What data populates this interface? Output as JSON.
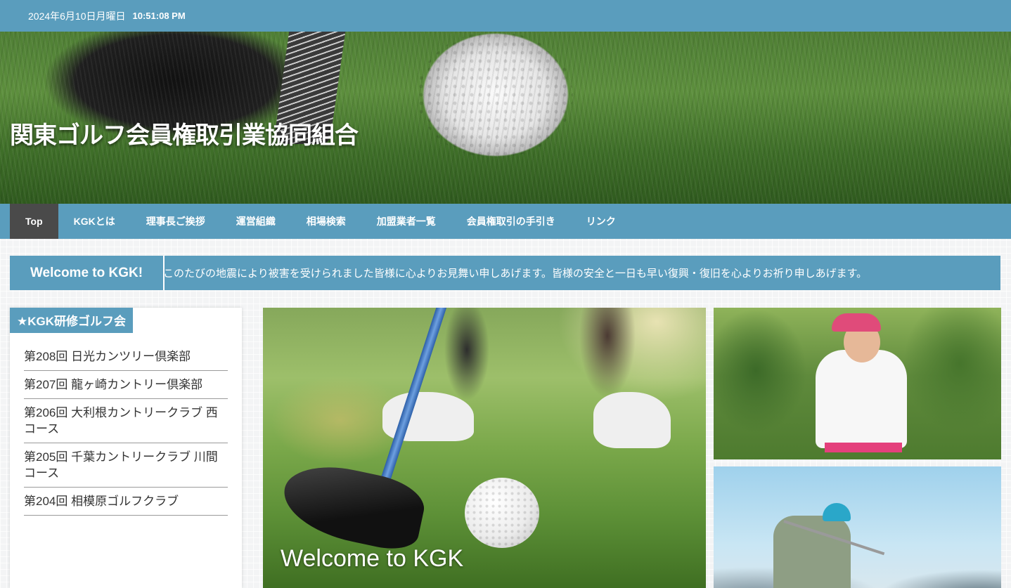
{
  "topbar": {
    "date": "2024年6月10日月曜日",
    "time": "10:51:08 PM"
  },
  "header": {
    "site_title": "関東ゴルフ会員権取引業協同組合"
  },
  "nav": {
    "items": [
      {
        "label": "Top"
      },
      {
        "label": "KGKとは"
      },
      {
        "label": "理事長ご挨拶"
      },
      {
        "label": "運営組織"
      },
      {
        "label": "相場検索"
      },
      {
        "label": "加盟業者一覧"
      },
      {
        "label": "会員権取引の手引き"
      },
      {
        "label": "リンク"
      }
    ]
  },
  "ticker": {
    "label": "Welcome to KGK!",
    "message": "このたびの地震により被害を受けられました皆様に心よりお見舞い申しあげます。皆様の安全と一日も早い復興・復旧を心よりお祈り申しあげます。"
  },
  "sidebar": {
    "heading": "★KGK研修ゴルフ会",
    "items": [
      {
        "label": "第208回 日光カンツリー倶楽部"
      },
      {
        "label": "第207回 龍ヶ崎カントリー倶楽部"
      },
      {
        "label": "第206回 大利根カントリークラブ 西コース"
      },
      {
        "label": "第205回 千葉カントリークラブ 川間コース"
      },
      {
        "label": "第204回 相模原ゴルフクラブ"
      }
    ]
  },
  "main": {
    "slide_caption": "Welcome to KGK"
  },
  "colors": {
    "accent": "#5a9dbd",
    "nav_active": "#4a4a4a"
  }
}
